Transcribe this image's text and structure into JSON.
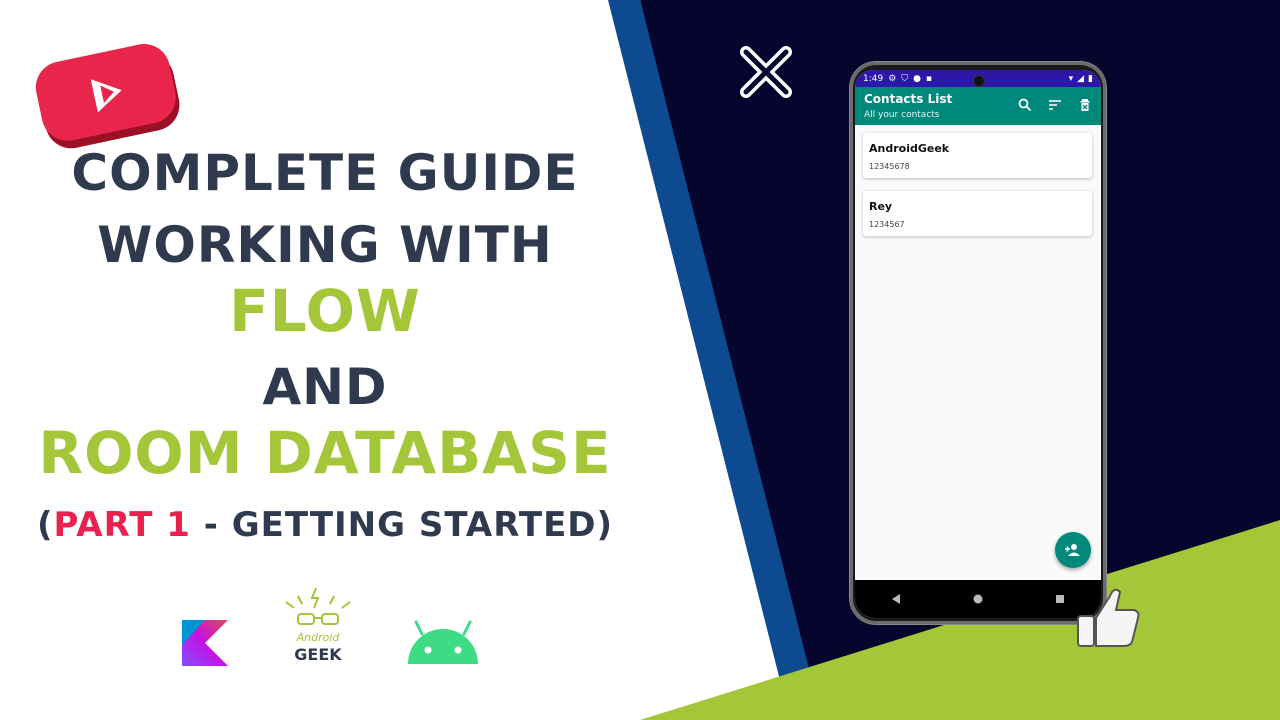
{
  "title": {
    "line1": "Complete Guide",
    "line2": "Working with",
    "line3": "Flow",
    "line4": "and",
    "line5": "Room Database",
    "line6_open": "(",
    "line6_part": "Part 1",
    "line6_rest": " - Getting Started)"
  },
  "colors": {
    "dark_text": "#2f3a4f",
    "green": "#a4c639",
    "pink": "#e8214f",
    "navy": "#06052e",
    "blue_stripe": "#0d4a8f",
    "teal": "#00897b",
    "status_bar": "#2d17a8"
  },
  "phone": {
    "status_time": "1:49",
    "app_title": "Contacts List",
    "app_subtitle": "All your contacts",
    "contacts": [
      {
        "name": "AndroidGeek",
        "phone": "12345678"
      },
      {
        "name": "Rey",
        "phone": "1234567"
      }
    ],
    "icons": [
      "search-icon",
      "sort-icon",
      "delete-all-icon",
      "add-contact-icon",
      "back-icon",
      "home-icon",
      "recents-icon"
    ]
  },
  "logos": {
    "brand_top": "Android",
    "brand_bottom": "GEEK",
    "icons": [
      "youtube-logo",
      "kotlin-logo",
      "androidgeek-logo",
      "android-logo",
      "close-icon",
      "thumbs-up-icon"
    ]
  }
}
